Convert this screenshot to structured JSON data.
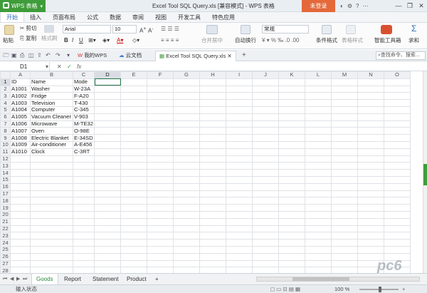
{
  "title_bar": {
    "app_name": "WPS 表格",
    "window_title": "Excel Tool SQL Query.xls [兼容模式] - WPS 表格",
    "login_button": "未登录"
  },
  "menu": {
    "tabs": [
      "开始",
      "插入",
      "页面布局",
      "公式",
      "数据",
      "审阅",
      "视图",
      "开发工具",
      "特色应用"
    ],
    "active": "开始"
  },
  "ribbon": {
    "paste": "粘贴",
    "cut": "剪切",
    "copy": "复制",
    "format_painter": "格式刷",
    "font_name": "Arial",
    "font_size": "10",
    "merge_center": "合并居中",
    "auto_wrap": "自动换行",
    "number_format": "常规",
    "conditional_format": "条件格式",
    "table_style": "表格样式",
    "smart_toolbox": "智能工具箱",
    "sum": "求和"
  },
  "doc_tabs": {
    "my_wps": "我的WPS",
    "cloud_docs": "云文档",
    "active_doc": "Excel Tool SQL Query.xls",
    "search_placeholder": "查找命令、搜索..."
  },
  "formula_bar": {
    "cell_ref": "D1",
    "fx": "fx",
    "content": ""
  },
  "sheet": {
    "columns": [
      "A",
      "B",
      "C",
      "D",
      "E",
      "F",
      "G",
      "H",
      "I",
      "J",
      "K",
      "L",
      "M",
      "N",
      "O"
    ],
    "selected_column": "D",
    "selected_row": 1,
    "row_count": 29,
    "rows": [
      [
        "ID",
        "Name",
        "Mode"
      ],
      [
        "A1001",
        "Washer",
        "W-23A"
      ],
      [
        "A1002",
        "Fridge",
        "F-A20"
      ],
      [
        "A1003",
        "Television",
        "T-430"
      ],
      [
        "A1004",
        "Computer",
        "C-345"
      ],
      [
        "A1005",
        "Vacuum Cleaner",
        "V-903"
      ],
      [
        "A1006",
        "Microwave",
        "M-TE32"
      ],
      [
        "A1007",
        "Oven",
        "O-98E"
      ],
      [
        "A1008",
        "Electric Blanket",
        "E-34SD"
      ],
      [
        "A1009",
        "Air-conditioner",
        "A-E456"
      ],
      [
        "A1010",
        "Clock",
        "C-3RT"
      ]
    ]
  },
  "sheet_tabs": [
    "Goods",
    "Report",
    "Statement",
    "Product"
  ],
  "active_sheet": "Goods",
  "status": {
    "mode": "输入状态",
    "zoom": "100 %"
  },
  "watermark": "pc6"
}
